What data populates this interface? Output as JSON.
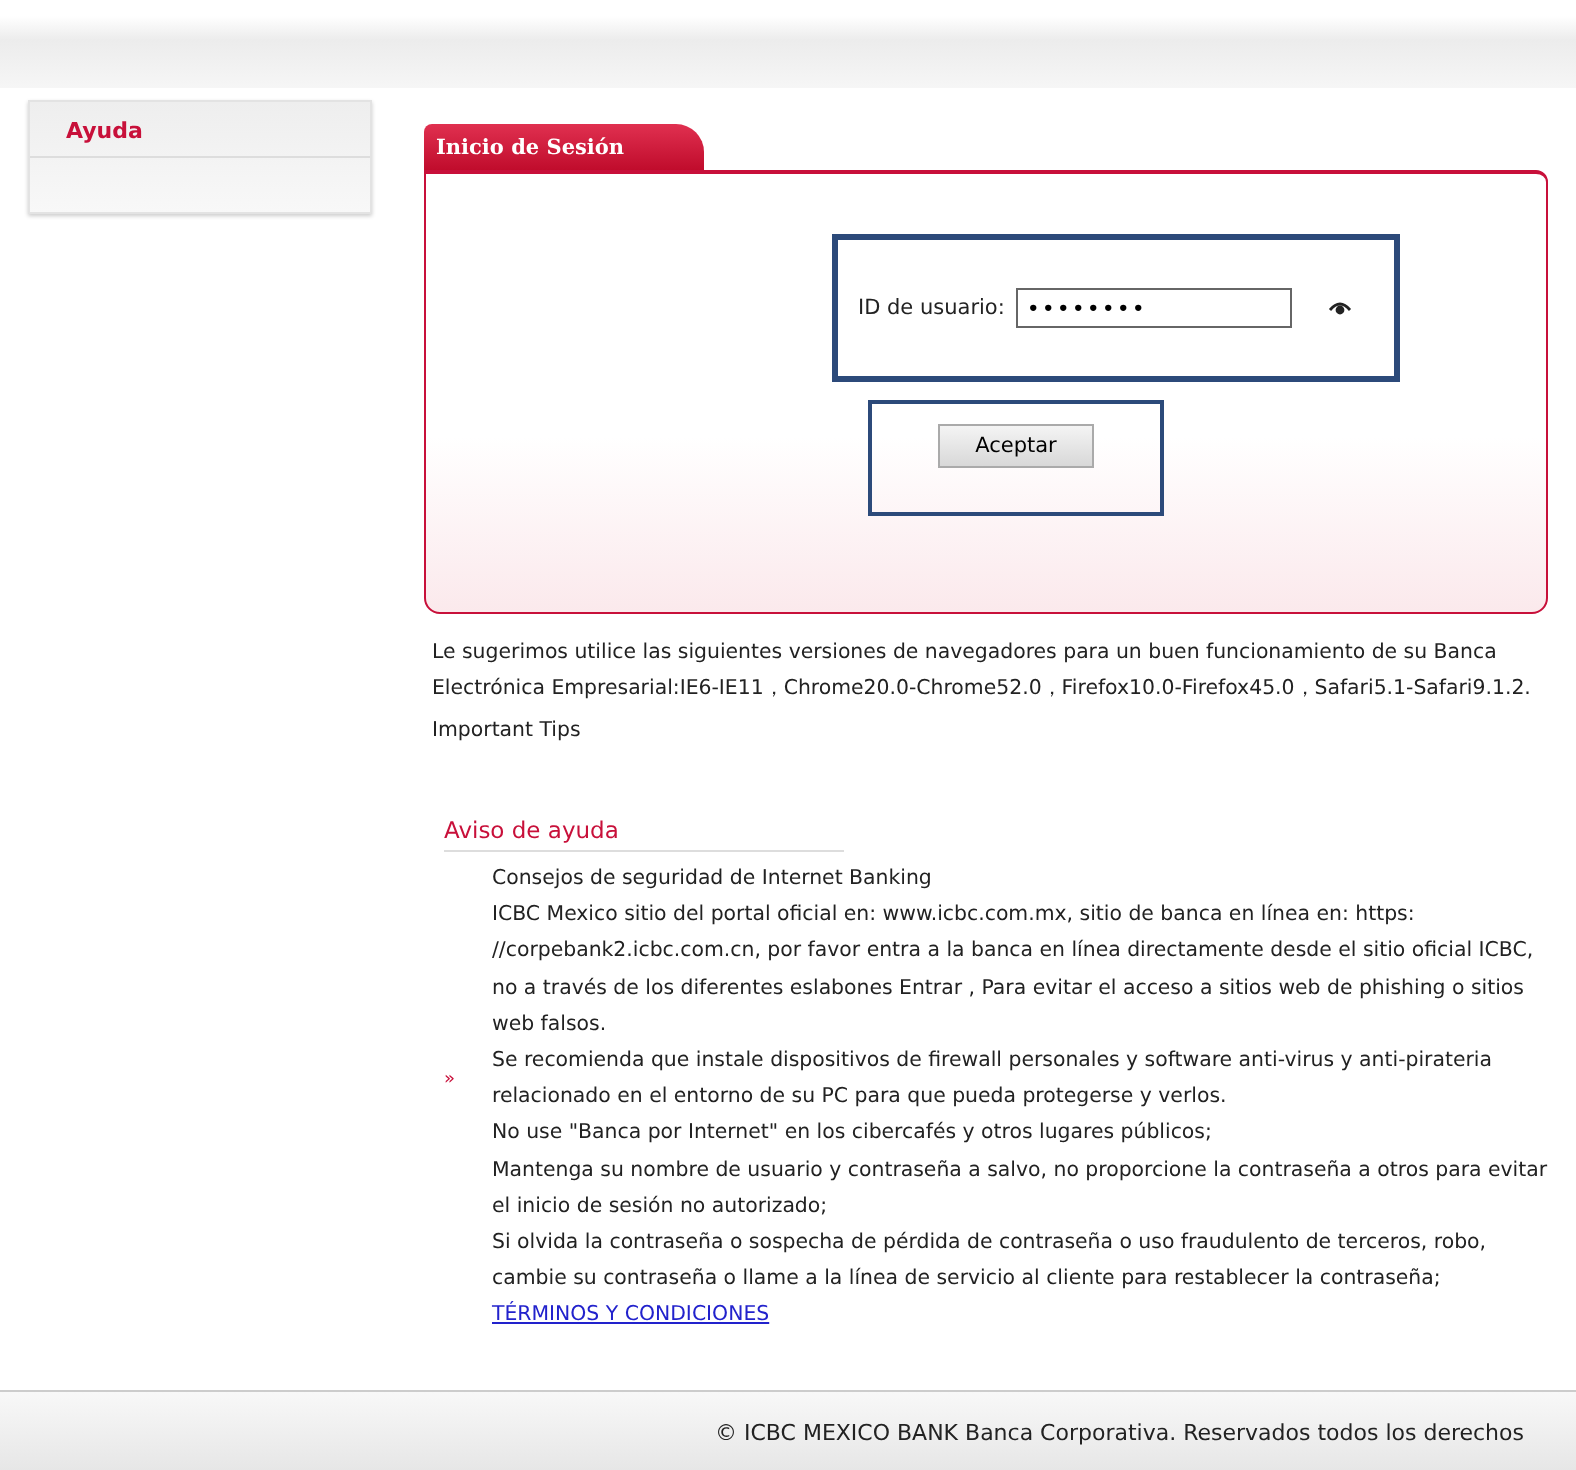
{
  "sidebar": {
    "items": [
      {
        "label": "Ayuda",
        "selected": true
      }
    ]
  },
  "login": {
    "tab": "Inicio de Sesión",
    "user_label": "ID de usuario:",
    "user_value": "••••••••",
    "button": "Aceptar"
  },
  "browser_note": "Le sugerimos utilice las siguientes versiones de navegadores para un buen funcionamiento de su Banca Electrónica Empresarial:IE6-IE11，Chrome20.0-Chrome52.0，Firefox10.0-Firefox45.0，Safari5.1-Safari9.1.2.",
  "important_tips": "Important Tips",
  "help": {
    "title": "Aviso de ayuda",
    "tips": [
      {
        "text": "Consejos de seguridad de Internet Banking"
      },
      {
        "text": "ICBC Mexico sitio del portal oficial en: www.icbc.com.mx, sitio de banca en línea en: https: //corpebank2.icbc.com.cn, por favor entra a la banca en línea directamente desde el sitio oficial ICBC, no a través de los diferentes eslabones Entrar , Para evitar el acceso a sitios web de phishing o sitios web falsos."
      },
      {
        "text": "Se recomienda que instale dispositivos de firewall personales y software anti-virus y anti-pirateria relacionado en el entorno de su PC para que pueda protegerse y verlos.",
        "marker": "»"
      },
      {
        "text": "No use \"Banca por Internet\" en los cibercafés y otros lugares públicos;"
      },
      {
        "text": "Mantenga su nombre de usuario y contraseña a salvo, no proporcione la contraseña a otros para evitar el inicio de sesión no autorizado;"
      },
      {
        "text": "Si olvida la contraseña o sospecha de pérdida de contraseña o uso fraudulento de terceros, robo, cambie su contraseña o llame a la línea de servicio al cliente para restablecer la contraseña;"
      }
    ],
    "link": "TÉRMINOS Y CONDICIONES"
  },
  "footer": "© ICBC MEXICO BANK Banca Corporativa. Reservados todos los derechos"
}
